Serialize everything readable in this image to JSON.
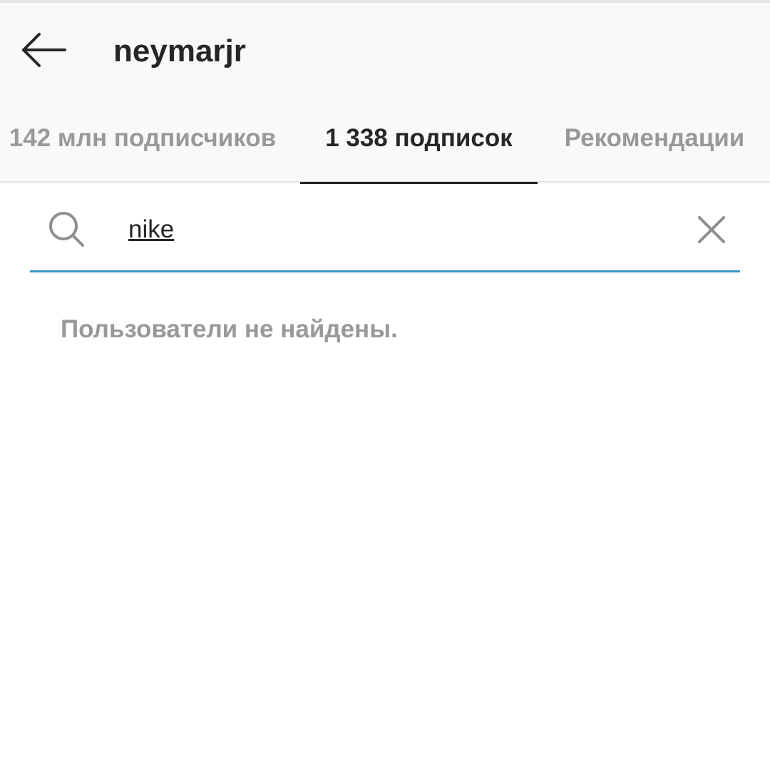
{
  "header": {
    "title": "neymarjr",
    "back_icon": "arrow-left-icon"
  },
  "tabs": [
    {
      "label": "142 млн подписчиков",
      "active": false
    },
    {
      "label": "1 338 подписок",
      "active": true
    },
    {
      "label": "Рекомендации",
      "active": false
    }
  ],
  "search": {
    "value": "nike",
    "placeholder": "",
    "search_icon": "search-icon",
    "clear_icon": "close-icon",
    "accent_color": "#3897c9"
  },
  "results": {
    "empty_message": "Пользователи не найдены."
  },
  "colors": {
    "header_background": "#f9f9f9",
    "text_primary": "#262626",
    "text_secondary": "#999999"
  }
}
